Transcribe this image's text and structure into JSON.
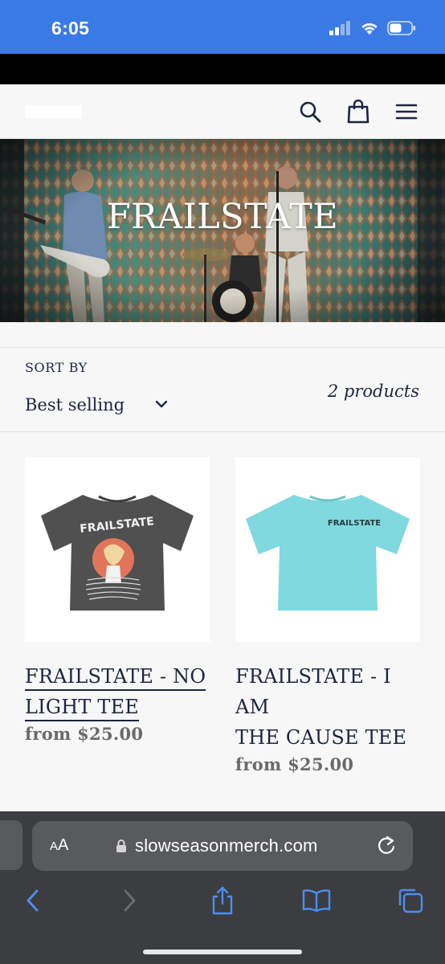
{
  "status_bar": {
    "time": "6:05",
    "icons": [
      "cellular-icon",
      "wifi-icon",
      "battery-icon"
    ]
  },
  "header": {
    "icons": [
      "search-icon",
      "shopping-bag-icon",
      "menu-icon"
    ]
  },
  "hero": {
    "title": "FRAILSTATE"
  },
  "sort": {
    "label": "SORT BY",
    "selected": "Best selling",
    "count": "2 products"
  },
  "products": [
    {
      "title_line1": "FRAILSTATE - NO",
      "title_line2": "LIGHT TEE",
      "price": "from $25.00",
      "shirt_color": "#505050",
      "print_text": "FRAILSTATE"
    },
    {
      "title_line1": "FRAILSTATE - I AM",
      "title_line2": "THE CAUSE TEE",
      "price": "from $25.00",
      "shirt_color": "#7fd9de",
      "print_text": "FRAILSTATE"
    }
  ],
  "browser": {
    "aa_big": "A",
    "aa_small": "A",
    "url": "slowseasonmerch.com",
    "toolbar": [
      "back-icon",
      "forward-icon",
      "share-icon",
      "bookmarks-icon",
      "tabs-icon"
    ]
  },
  "colors": {
    "status_bar": "#3a7ae4",
    "text": "#1c2540",
    "price": "#6a6a6a",
    "browser_accent": "#4a8ff0"
  }
}
